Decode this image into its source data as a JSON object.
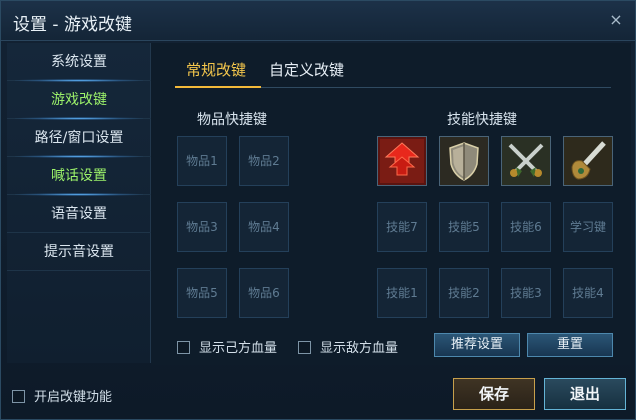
{
  "window": {
    "title": "设置 - 游戏改键",
    "close_glyph": "×"
  },
  "sidebar": {
    "items": [
      {
        "label": "系统设置",
        "active": false
      },
      {
        "label": "游戏改键",
        "active": true
      },
      {
        "label": "路径/窗口设置",
        "active": false
      },
      {
        "label": "喊话设置",
        "active": true
      },
      {
        "label": "语音设置",
        "active": false
      },
      {
        "label": "提示音设置",
        "active": false
      }
    ]
  },
  "tabs": {
    "regular": "常规改键",
    "custom": "自定义改键"
  },
  "items_section": {
    "label": "物品快捷键",
    "slots": [
      "物品1",
      "物品2",
      "物品3",
      "物品4",
      "物品5",
      "物品6"
    ]
  },
  "skills_section": {
    "label": "技能快捷键",
    "icons": [
      "red-arrow-skill-icon",
      "shield-skill-icon",
      "crossed-swords-skill-icon",
      "sword-glove-skill-icon"
    ],
    "row2": [
      "技能7",
      "技能5",
      "技能6",
      "学习键"
    ],
    "row3": [
      "技能1",
      "技能2",
      "技能3",
      "技能4"
    ]
  },
  "options": {
    "show_own_hp": "显示己方血量",
    "show_enemy_hp": "显示敌方血量"
  },
  "buttons": {
    "recommend": "推荐设置",
    "reset": "重置",
    "save": "保存",
    "exit": "退出"
  },
  "footer": {
    "enable_remap": "开启改键功能"
  },
  "colors": {
    "accent_gold": "#f3c64c",
    "active_green": "#9cf26a",
    "save_border": "#c7a04c",
    "exit_border": "#64b4d6"
  }
}
